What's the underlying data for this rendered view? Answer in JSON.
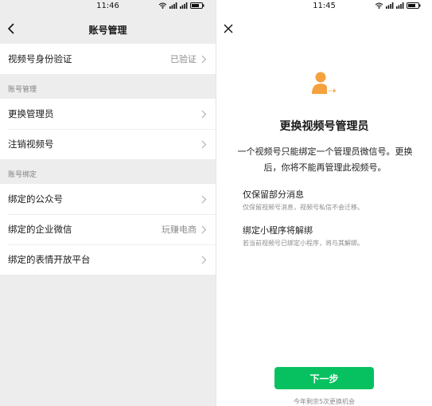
{
  "left": {
    "status_time": "11:46",
    "nav_title": "账号管理",
    "verify_row": {
      "label": "视频号身份验证",
      "value": "已验证"
    },
    "section_account": "账号管理",
    "account_items": [
      {
        "label": "更换管理员"
      },
      {
        "label": "注销视频号"
      }
    ],
    "section_binding": "账号绑定",
    "binding_items": [
      {
        "label": "绑定的公众号",
        "value": ""
      },
      {
        "label": "绑定的企业微信",
        "value": "玩赚电商"
      },
      {
        "label": "绑定的表情开放平台",
        "value": ""
      }
    ]
  },
  "right": {
    "status_time": "11:45",
    "title": "更换视频号管理员",
    "description": "一个视频号只能绑定一个管理员微信号。更换后，你将不能再管理此视频号。",
    "options": [
      {
        "title": "仅保留部分消息",
        "subtitle": "仅保留视频号消息，视频号私信不会迁移。"
      },
      {
        "title": "绑定小程序将解绑",
        "subtitle": "若当前视频号已绑定小程序，将与其解绑。"
      }
    ],
    "next_button": "下一步",
    "footer_note": "今年剩余5次更换机会"
  },
  "colors": {
    "accent_green": "#07c160",
    "illustration_orange": "#f5a13d",
    "page_gray": "#ededed"
  },
  "icons": [
    "back-arrow-icon",
    "close-icon",
    "chevron-right-icon",
    "wifi-icon",
    "signal-icon",
    "battery-icon",
    "transfer-user-icon"
  ]
}
